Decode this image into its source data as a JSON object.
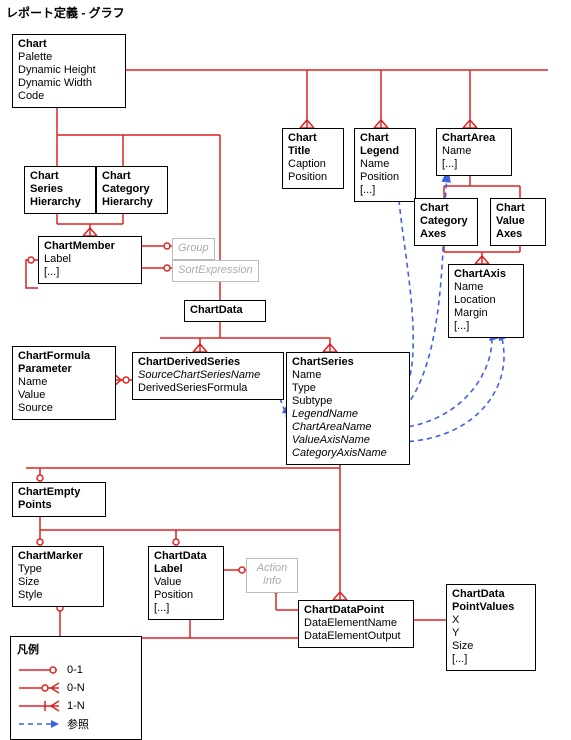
{
  "title": "レポート定義 - グラフ",
  "boxes": {
    "chart": {
      "title": "Chart",
      "rows": [
        "Palette",
        "Dynamic Height",
        "Dynamic Width",
        "Code"
      ]
    },
    "chartSeriesHierarchy": {
      "title": "Chart Series Hierarchy",
      "rows": []
    },
    "chartCategoryHierarchy": {
      "title": "Chart Category Hierarchy",
      "rows": []
    },
    "chartMember": {
      "title": "ChartMember",
      "rows": [
        "Label",
        "[...]"
      ]
    },
    "group": {
      "title": "Group",
      "ghost": true
    },
    "sortExpression": {
      "title": "SortExpression",
      "ghost": true
    },
    "chartTitle": {
      "title": "Chart Title",
      "rows": [
        "Caption",
        "Position"
      ]
    },
    "chartLegend": {
      "title": "Chart Legend",
      "rows": [
        "Name",
        "Position",
        "[...]"
      ]
    },
    "chartArea": {
      "title": "ChartArea",
      "rows": [
        "Name",
        "[...]"
      ]
    },
    "chartCategoryAxes": {
      "title": "Chart Category Axes",
      "rows": []
    },
    "chartValueAxes": {
      "title": "Chart Value Axes",
      "rows": []
    },
    "chartAxis": {
      "title": "ChartAxis",
      "rows": [
        "Name",
        "Location",
        "Margin",
        "[...]"
      ]
    },
    "chartData": {
      "title": "ChartData",
      "rows": []
    },
    "chartFormulaParameter": {
      "title": "ChartFormula Parameter",
      "rows": [
        "Name",
        "Value",
        "Source"
      ]
    },
    "chartDerivedSeries": {
      "title": "ChartDerivedSeries",
      "rows_ital": [
        "SourceChartSeriesName"
      ],
      "rows": [
        "DerivedSeriesFormula"
      ]
    },
    "chartSeries": {
      "title": "ChartSeries",
      "rows": [
        "Name",
        "Type",
        "Subtype"
      ],
      "rows_ital": [
        "LegendName",
        "ChartAreaName",
        "ValueAxisName",
        "CategoryAxisName"
      ]
    },
    "chartEmptyPoints": {
      "title": "ChartEmpty Points",
      "rows": []
    },
    "chartMarker": {
      "title": "ChartMarker",
      "rows": [
        "Type",
        "Size",
        "Style"
      ]
    },
    "chartDataLabel": {
      "title": "ChartData Label",
      "rows": [
        "Value",
        "Position",
        "[...]"
      ]
    },
    "actionInfo": {
      "title": "Action Info",
      "ghost": true
    },
    "chartDataPoint": {
      "title": "ChartDataPoint",
      "rows": [
        "DataElementName",
        "DataElementOutput"
      ]
    },
    "chartDataPointValues": {
      "title": "ChartData PointValues",
      "rows": [
        "X",
        "Y",
        "Size",
        "[...]"
      ]
    }
  },
  "legend": {
    "title": "凡例",
    "items": [
      {
        "kind": "0-1",
        "label": "0-1"
      },
      {
        "kind": "0-N",
        "label": "0-N"
      },
      {
        "kind": "1-N",
        "label": "1-N"
      },
      {
        "kind": "ref",
        "label": "参照"
      }
    ]
  }
}
